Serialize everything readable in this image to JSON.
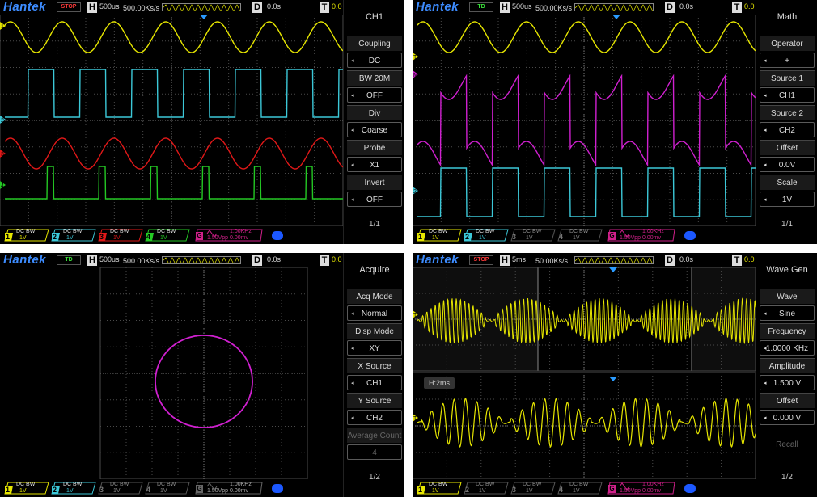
{
  "colors": {
    "ch1": "#e6e600",
    "ch2": "#3cc8d8",
    "ch3": "#e01818",
    "ch4": "#24c824",
    "math": "#d020d0",
    "gen": "#d0208a",
    "grid": "#4a4a4a",
    "logo": "#3d8cff"
  },
  "panels": {
    "ch1": {
      "logo": "Hantek",
      "run_state": "STOP",
      "h_box": "H",
      "time_base": "500us",
      "sample_rate": "500.00Ks/s",
      "d_box": "D",
      "delay": "0.0s",
      "t_box": "T",
      "trigger_level": "0.0",
      "menu_title": "CH1",
      "menu": [
        {
          "label": "Coupling",
          "value": "DC"
        },
        {
          "label": "BW 20M",
          "value": "OFF"
        },
        {
          "label": "Div",
          "value": "Coarse"
        },
        {
          "label": "Probe",
          "value": "X1"
        },
        {
          "label": "Invert",
          "value": "OFF"
        }
      ],
      "page": "1/1",
      "channels": [
        {
          "num": "1",
          "top": "DC  BW",
          "bottom": "1V"
        },
        {
          "num": "2",
          "top": "DC  BW",
          "bottom": "1V"
        },
        {
          "num": "3",
          "top": "DC  BW",
          "bottom": "1V"
        },
        {
          "num": "4",
          "top": "DC  BW",
          "bottom": "1V"
        }
      ],
      "gen": {
        "g": "G",
        "freq": "1.00KHz",
        "amp": "1.50Vpp 0.00mv"
      }
    },
    "math": {
      "logo": "Hantek",
      "run_state": "TD",
      "h_box": "H",
      "time_base": "500us",
      "sample_rate": "500.00Ks/s",
      "d_box": "D",
      "delay": "0.0s",
      "t_box": "T",
      "trigger_level": "0.0",
      "menu_title": "Math",
      "menu": [
        {
          "label": "Operator",
          "value": "+"
        },
        {
          "label": "Source 1",
          "value": "CH1"
        },
        {
          "label": "Source 2",
          "value": "CH2"
        },
        {
          "label": "Offset",
          "value": "0.0V"
        },
        {
          "label": "Scale",
          "value": "1V"
        }
      ],
      "page": "1/1",
      "channels": [
        {
          "num": "1",
          "top": "DC  BW",
          "bottom": "1V"
        },
        {
          "num": "2",
          "top": "DC  BW",
          "bottom": "1V"
        },
        {
          "num": "3",
          "top": "DC  BW",
          "bottom": "1V"
        },
        {
          "num": "4",
          "top": "DC  BW",
          "bottom": "1V"
        }
      ],
      "gen": {
        "g": "G",
        "freq": "1.00KHz",
        "amp": "1.50Vpp 0.00mv"
      }
    },
    "acquire": {
      "logo": "Hantek",
      "run_state": "TD",
      "h_box": "H",
      "time_base": "500us",
      "sample_rate": "500.00Ks/s",
      "d_box": "D",
      "delay": "0.0s",
      "t_box": "T",
      "trigger_level": "0.0",
      "menu_title": "Acquire",
      "menu": [
        {
          "label": "Acq Mode",
          "value": "Normal"
        },
        {
          "label": "Disp Mode",
          "value": "XY"
        },
        {
          "label": "X Source",
          "value": "CH1"
        },
        {
          "label": "Y Source",
          "value": "CH2"
        },
        {
          "label": "Average Count",
          "value": "4"
        }
      ],
      "page": "1/2",
      "channels": [
        {
          "num": "1",
          "top": "DC  BW",
          "bottom": "1V"
        },
        {
          "num": "2",
          "top": "DC  BW",
          "bottom": "1V"
        },
        {
          "num": "3",
          "top": "DC  BW",
          "bottom": "1V"
        },
        {
          "num": "4",
          "top": "DC  BW",
          "bottom": "1V"
        }
      ],
      "gen": {
        "g": "G",
        "freq": "1.00KHz",
        "amp": "1.50Vpp 0.00mv"
      }
    },
    "wavegen": {
      "logo": "Hantek",
      "run_state": "STOP",
      "h_box": "H",
      "time_base": "5ms",
      "sample_rate": "50.00Ks/s",
      "d_box": "D",
      "delay": "0.0s",
      "t_box": "T",
      "trigger_level": "0.0",
      "zoom_label": "H:2ms",
      "menu_title": "Wave Gen",
      "menu": [
        {
          "label": "Wave",
          "value": "Sine"
        },
        {
          "label": "Frequency",
          "value": "1.0000 KHz"
        },
        {
          "label": "Amplitude",
          "value": "1.500 V"
        },
        {
          "label": "Offset",
          "value": "0.000 V"
        },
        {
          "label": "Recall",
          "value": ""
        }
      ],
      "page": "1/2",
      "channels": [
        {
          "num": "1",
          "top": "DC  BW",
          "bottom": "1V"
        },
        {
          "num": "2",
          "top": "DC  BW",
          "bottom": "1V"
        },
        {
          "num": "3",
          "top": "DC  BW",
          "bottom": "1V"
        },
        {
          "num": "4",
          "top": "DC  BW",
          "bottom": "1V"
        }
      ],
      "gen": {
        "g": "G",
        "freq": "1.00KHz",
        "amp": "1.50Vpp 0.00mv"
      }
    }
  }
}
